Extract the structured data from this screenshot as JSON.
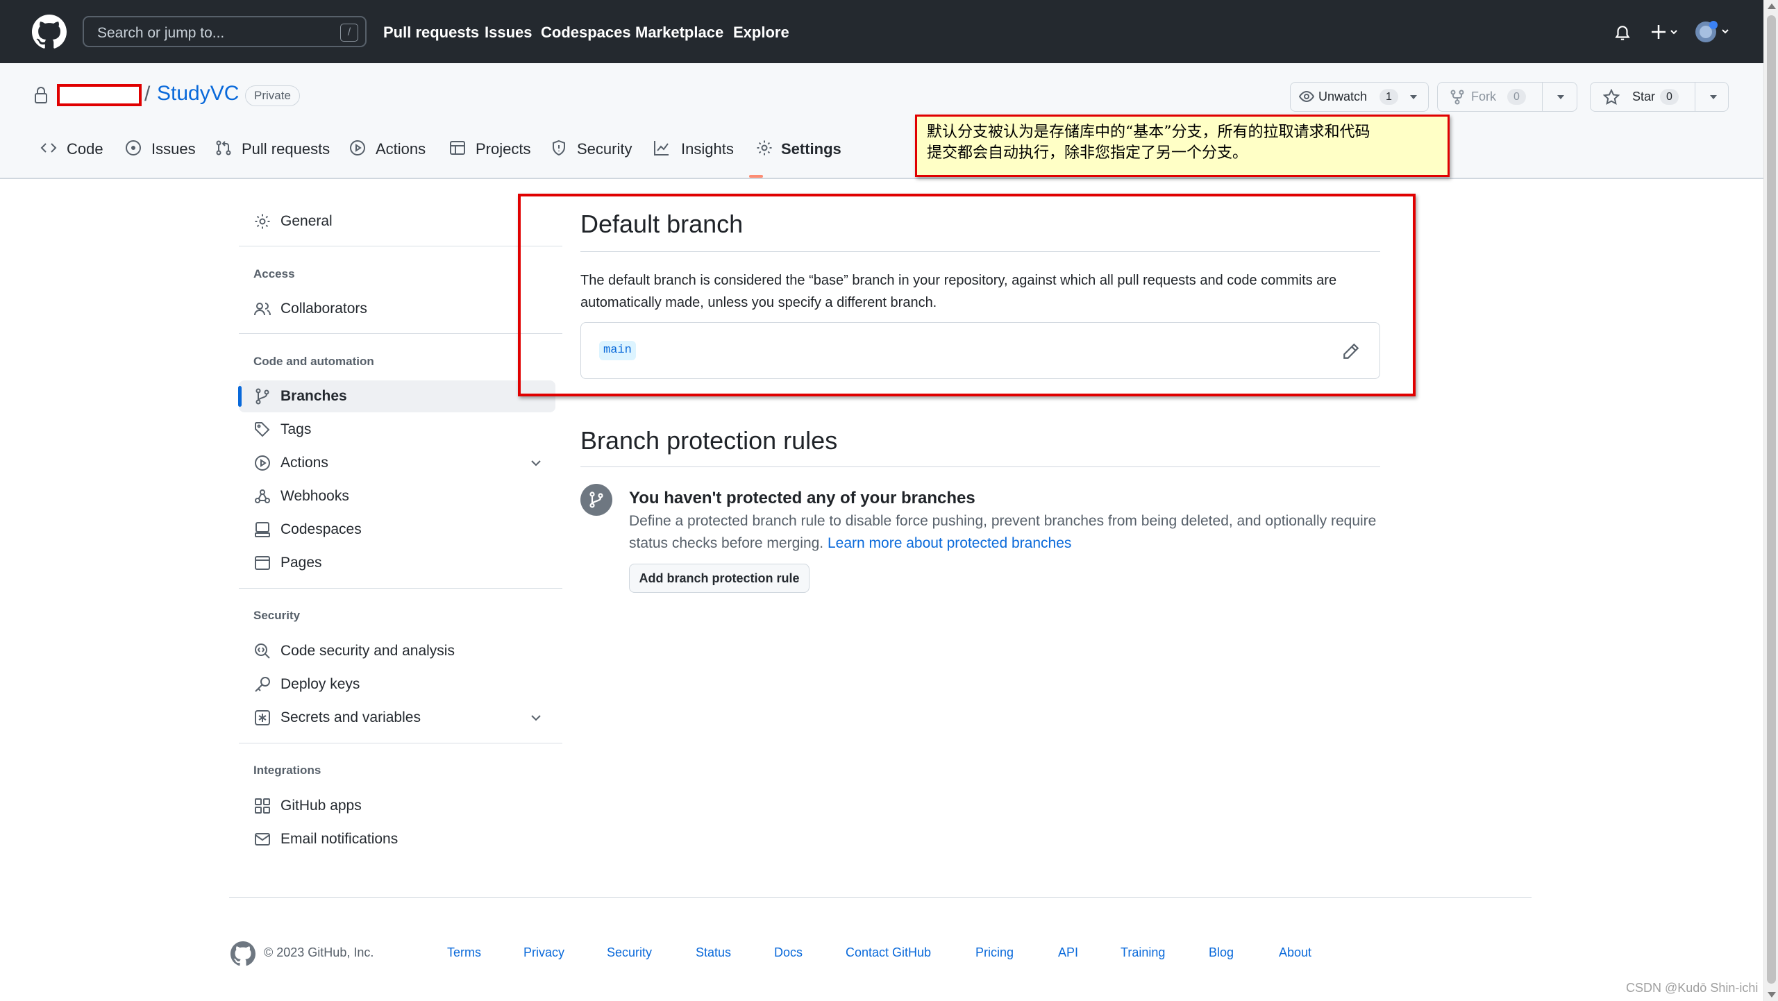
{
  "header": {
    "search_placeholder": "Search or jump to...",
    "search_shortcut": "/",
    "nav": [
      "Pull requests",
      "Issues",
      "Codespaces",
      "Marketplace",
      "Explore"
    ],
    "bg_color": "#24292f"
  },
  "repo": {
    "separator": "/",
    "name": "StudyVC",
    "visibility": "Private",
    "watch_label": "Unwatch",
    "watch_count": "1",
    "fork_label": "Fork",
    "fork_count": "0",
    "star_label": "Star",
    "star_count": "0",
    "link_color": "#0969da"
  },
  "tabs": [
    {
      "label": "Code",
      "icon": "code-icon"
    },
    {
      "label": "Issues",
      "icon": "issue-icon"
    },
    {
      "label": "Pull requests",
      "icon": "pull-request-icon"
    },
    {
      "label": "Actions",
      "icon": "play-icon"
    },
    {
      "label": "Projects",
      "icon": "table-icon"
    },
    {
      "label": "Security",
      "icon": "shield-icon"
    },
    {
      "label": "Insights",
      "icon": "graph-icon"
    },
    {
      "label": "Settings",
      "icon": "gear-icon",
      "active": true
    }
  ],
  "annotation": {
    "line1": "默认分支被认为是存储库中的“基本”分支，所有的拉取请求和代码",
    "line2": "提交都会自动执行，除非您指定了另一个分支。"
  },
  "sidebar": {
    "general": "General",
    "access_heading": "Access",
    "collaborators": "Collaborators",
    "code_heading": "Code and automation",
    "branches": "Branches",
    "tags": "Tags",
    "actions": "Actions",
    "webhooks": "Webhooks",
    "codespaces": "Codespaces",
    "pages": "Pages",
    "security_heading": "Security",
    "code_security": "Code security and analysis",
    "deploy_keys": "Deploy keys",
    "secrets": "Secrets and variables",
    "integrations_heading": "Integrations",
    "github_apps": "GitHub apps",
    "email_notifications": "Email notifications"
  },
  "default_branch": {
    "title": "Default branch",
    "description": "The default branch is considered the “base” branch in your repository, against which all pull requests and code commits are automatically made, unless you specify a different branch.",
    "branch_name": "main"
  },
  "protection": {
    "title": "Branch protection rules",
    "blank_title": "You haven't protected any of your branches",
    "blank_text": "Define a protected branch rule to disable force pushing, prevent branches from being deleted, and optionally require status checks before merging.",
    "learn_more": "Learn more about protected branches",
    "add_button": "Add branch protection rule"
  },
  "footer": {
    "copyright": "© 2023 GitHub, Inc.",
    "links": [
      "Terms",
      "Privacy",
      "Security",
      "Status",
      "Docs",
      "Contact GitHub",
      "Pricing",
      "API",
      "Training",
      "Blog",
      "About"
    ]
  },
  "watermark": "CSDN @Kudō Shin-ichi"
}
